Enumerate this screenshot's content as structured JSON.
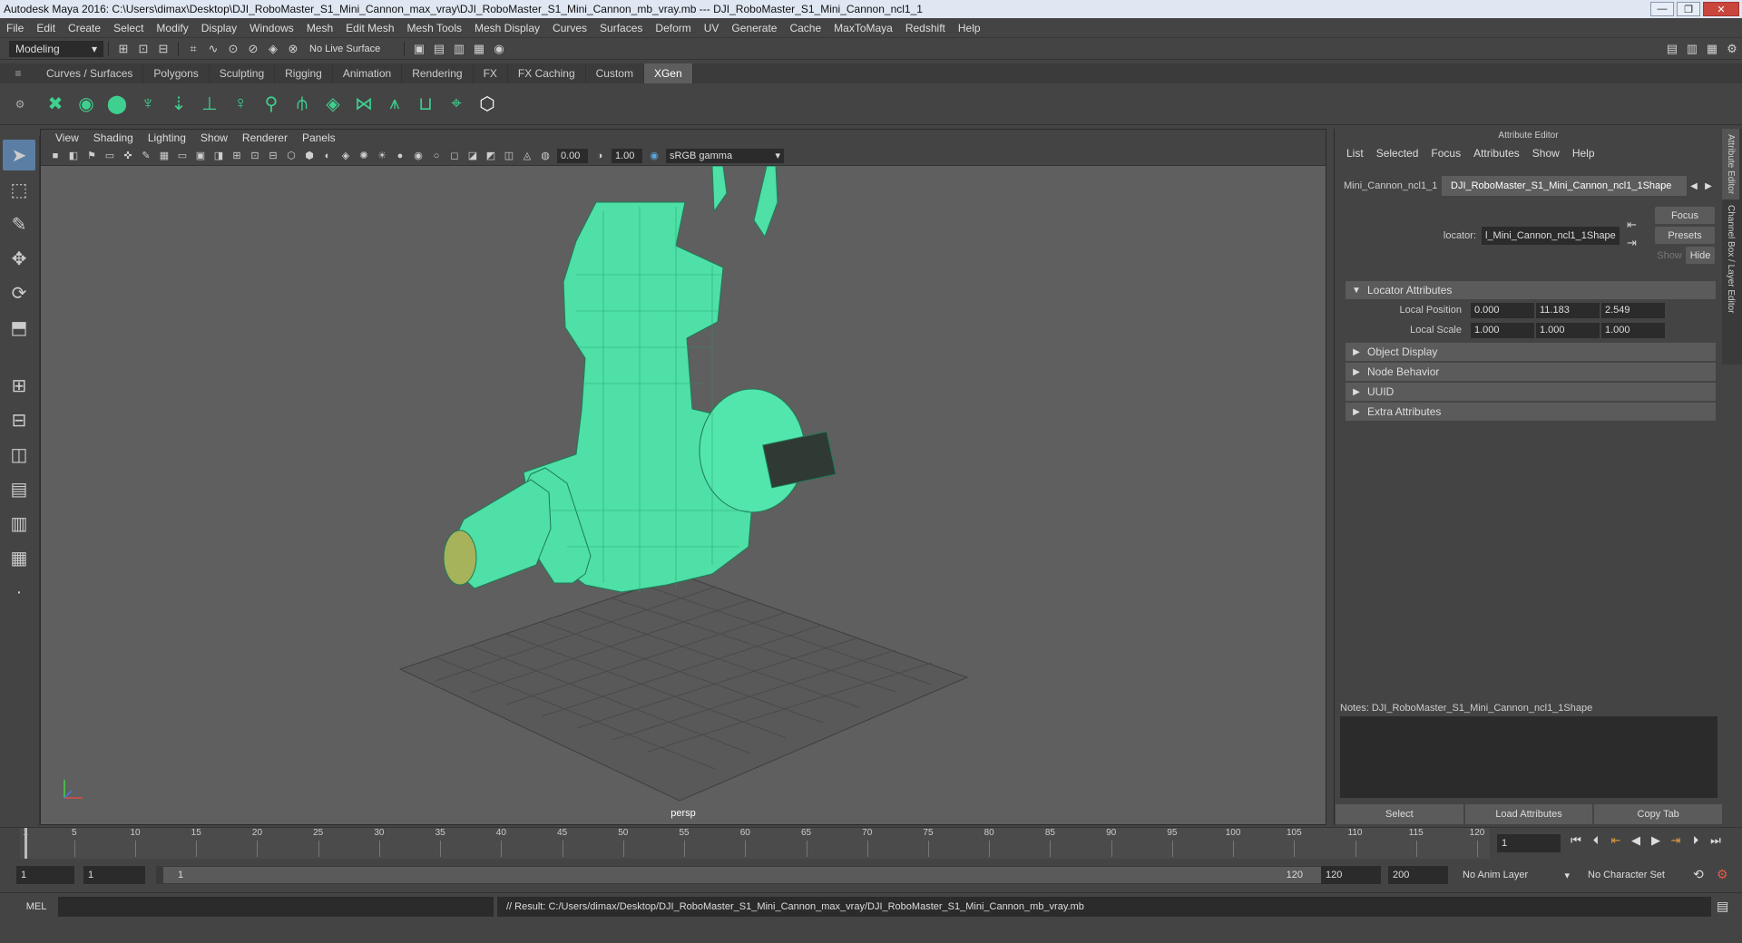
{
  "window": {
    "title": "Autodesk Maya 2016: C:\\Users\\dimax\\Desktop\\DJI_RoboMaster_S1_Mini_Cannon_max_vray\\DJI_RoboMaster_S1_Mini_Cannon_mb_vray.mb   ---   DJI_RoboMaster_S1_Mini_Cannon_ncl1_1"
  },
  "menubar": [
    "File",
    "Edit",
    "Create",
    "Select",
    "Modify",
    "Display",
    "Windows",
    "Mesh",
    "Edit Mesh",
    "Mesh Tools",
    "Mesh Display",
    "Curves",
    "Surfaces",
    "Deform",
    "UV",
    "Generate",
    "Cache",
    "MaxToMaya",
    "Redshift",
    "Help"
  ],
  "statusline": {
    "mode": "Modeling",
    "live_surface": "No Live Surface"
  },
  "shelf_tabs": [
    "Curves / Surfaces",
    "Polygons",
    "Sculpting",
    "Rigging",
    "Animation",
    "Rendering",
    "FX",
    "FX Caching",
    "Custom",
    "XGen"
  ],
  "active_shelf_tab": "XGen",
  "viewport": {
    "menu": [
      "View",
      "Shading",
      "Lighting",
      "Show",
      "Renderer",
      "Panels"
    ],
    "exposure": "0.00",
    "gamma": "1.00",
    "color_space": "sRGB gamma",
    "camera_label": "persp"
  },
  "attribute_editor": {
    "title": "Attribute Editor",
    "menu": [
      "List",
      "Selected",
      "Focus",
      "Attributes",
      "Show",
      "Help"
    ],
    "tabs": [
      "Mini_Cannon_ncl1_1",
      "DJI_RoboMaster_S1_Mini_Cannon_ncl1_1Shape"
    ],
    "locator_label": "locator:",
    "locator_value": "l_Mini_Cannon_ncl1_1Shape",
    "focus_btn": "Focus",
    "presets_btn": "Presets",
    "show_btn": "Show",
    "hide_btn": "Hide",
    "sections": {
      "locator": "Locator Attributes",
      "object_display": "Object Display",
      "node_behavior": "Node Behavior",
      "uuid": "UUID",
      "extra": "Extra Attributes"
    },
    "local_position_label": "Local Position",
    "local_position": [
      "0.000",
      "11.183",
      "2.549"
    ],
    "local_scale_label": "Local Scale",
    "local_scale": [
      "1.000",
      "1.000",
      "1.000"
    ],
    "notes_label": "Notes:  DJI_RoboMaster_S1_Mini_Cannon_ncl1_1Shape",
    "bottom_buttons": {
      "select": "Select",
      "load": "Load Attributes",
      "copy": "Copy Tab"
    }
  },
  "side_tabs": [
    "Attribute Editor",
    "Channel Box / Layer Editor"
  ],
  "timeline": {
    "ticks": [
      "1",
      "5",
      "10",
      "15",
      "20",
      "25",
      "30",
      "35",
      "40",
      "45",
      "50",
      "55",
      "60",
      "65",
      "70",
      "75",
      "80",
      "85",
      "90",
      "95",
      "100",
      "105",
      "110",
      "115",
      "120"
    ],
    "current_frame": "1"
  },
  "range": {
    "start": "1",
    "playback_start": "1",
    "slider_start": "1",
    "slider_end": "120",
    "playback_end": "120",
    "end": "200",
    "anim_layer": "No Anim Layer",
    "character_set": "No Character Set"
  },
  "command_line": {
    "lang": "MEL",
    "result": "// Result: C:/Users/dimax/Desktop/DJI_RoboMaster_S1_Mini_Cannon_max_vray/DJI_RoboMaster_S1_Mini_Cannon_mb_vray.mb"
  }
}
